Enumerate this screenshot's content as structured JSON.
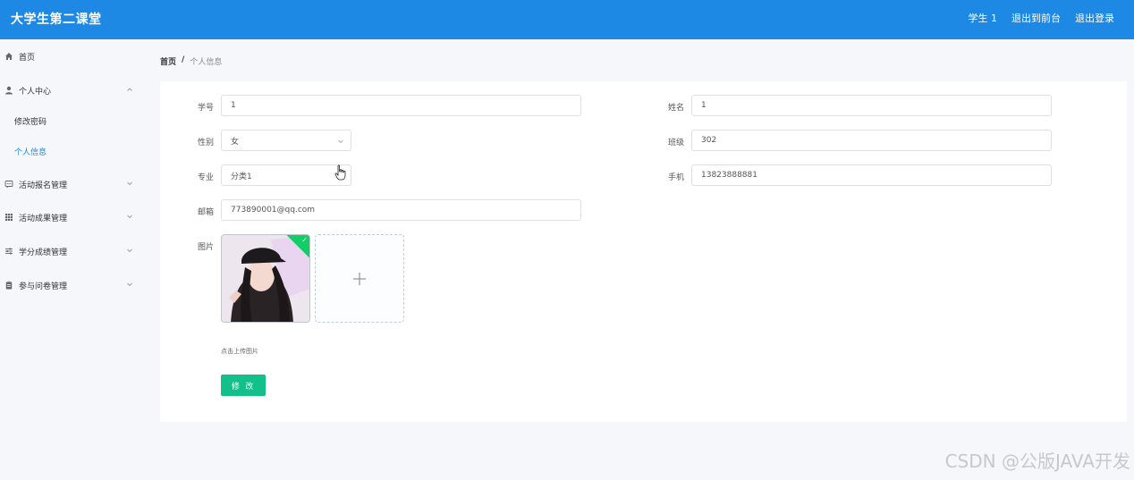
{
  "header": {
    "title": "大学生第二课堂",
    "nav": [
      "学生 1",
      "退出到前台",
      "退出登录"
    ]
  },
  "sidebar": {
    "items": [
      {
        "label": "首页",
        "icon": "home-icon"
      },
      {
        "label": "个人中心",
        "icon": "user-icon",
        "expanded": true
      },
      {
        "label": "修改密码"
      },
      {
        "label": "个人信息",
        "active": true
      },
      {
        "label": "活动报名管理",
        "icon": "chat-icon"
      },
      {
        "label": "活动成果管理",
        "icon": "grid-icon"
      },
      {
        "label": "学分成绩管理",
        "icon": "sliders-icon"
      },
      {
        "label": "参与问卷管理",
        "icon": "clipboard-icon"
      }
    ]
  },
  "breadcrumb": {
    "home": "首页",
    "separator": "/",
    "current": "个人信息"
  },
  "form": {
    "student_id": {
      "label": "学号",
      "value": "1"
    },
    "name": {
      "label": "姓名",
      "value": "1"
    },
    "gender": {
      "label": "性别",
      "value": "女"
    },
    "class": {
      "label": "班级",
      "value": "302"
    },
    "major": {
      "label": "专业",
      "value": "分类1"
    },
    "phone": {
      "label": "手机",
      "value": "13823888881"
    },
    "email": {
      "label": "邮箱",
      "value": "773890001@qq.com"
    },
    "picture": {
      "label": "图片",
      "tip": "点击上传图片"
    },
    "submit_label": "修 改"
  },
  "watermark": "CSDN @公版JAVA开发",
  "colors": {
    "header": "#1e88e5",
    "success": "#13c08a",
    "active_menu": "#1e88e5"
  }
}
